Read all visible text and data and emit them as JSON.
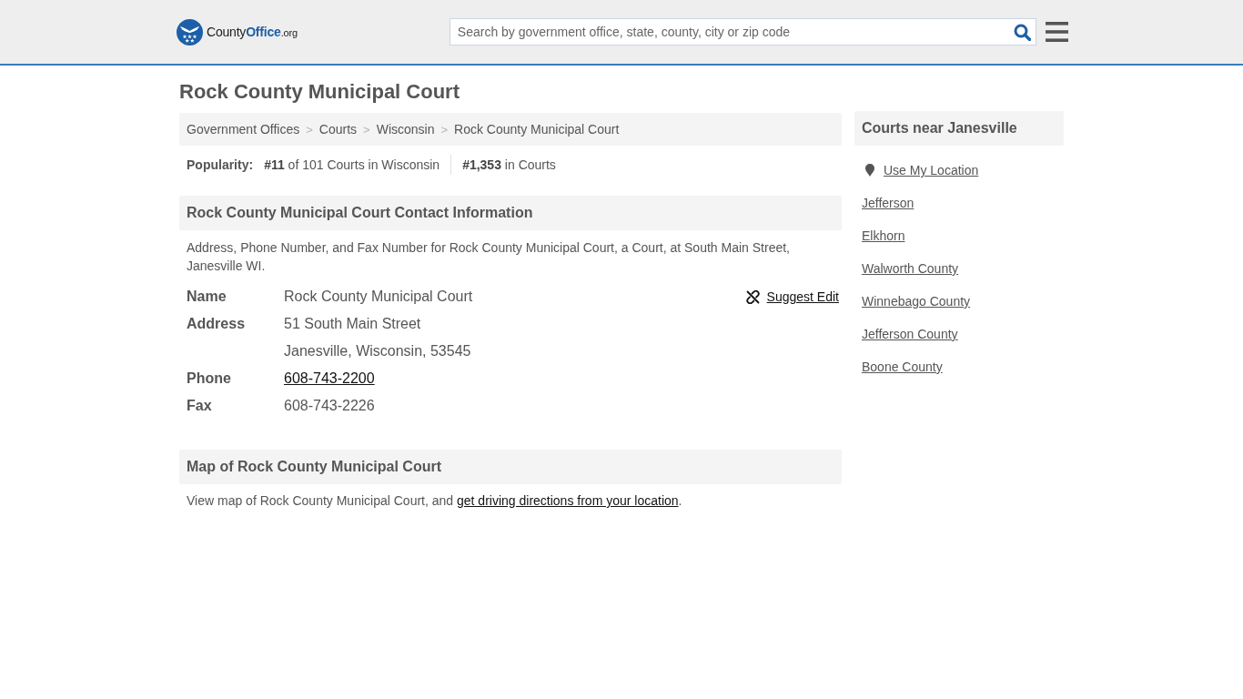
{
  "header": {
    "logo": {
      "parts": [
        {
          "text": "County",
          "kind": "plain"
        },
        {
          "text": "Office",
          "kind": "accent"
        },
        {
          "text": ".org",
          "kind": "suffix"
        }
      ]
    },
    "search": {
      "placeholder": "Search by government office, state, county, city or zip code"
    }
  },
  "page_title": "Rock County Municipal Court",
  "breadcrumbs": [
    {
      "label": "Government Offices"
    },
    {
      "label": "Courts",
      "separator": ">"
    },
    {
      "label": "Wisconsin",
      "separator": ">"
    },
    {
      "label": "Rock County Municipal Court",
      "separator": ">"
    }
  ],
  "popularity": {
    "label": "Popularity:",
    "ranks": [
      "**#11** of 101 Courts in Wisconsin",
      "**#1,353** in Courts"
    ]
  },
  "contact": {
    "title": "Rock County Municipal Court Contact Information",
    "description": "Address, Phone Number, and Fax Number for Rock County Municipal Court, a Court, at South Main Street, Janesville WI.",
    "suggest_edit": "Suggest Edit",
    "fields": [
      {
        "label": "Name",
        "kind": "text",
        "lines": [
          "Rock County Municipal Court"
        ]
      },
      {
        "label": "Address",
        "kind": "text",
        "lines": [
          "51 South Main Street",
          "Janesville, Wisconsin, 53545"
        ]
      },
      {
        "label": "Phone",
        "kind": "link",
        "lines": [
          "608-743-2200"
        ]
      },
      {
        "label": "Fax",
        "kind": "text",
        "lines": [
          "608-743-2226"
        ]
      }
    ]
  },
  "map": {
    "title": "Map of Rock County Municipal Court",
    "text": "View map of Rock County Municipal Court, and ",
    "link": "get driving directions from your location",
    "text_end": "."
  },
  "sidebar": {
    "title": "Courts near Janesville",
    "items": [
      {
        "label": "Use My Location",
        "kind": "location"
      },
      {
        "label": "Jefferson",
        "kind": "link"
      },
      {
        "label": "Elkhorn",
        "kind": "link"
      },
      {
        "label": "Walworth County",
        "kind": "link"
      },
      {
        "label": "Winnebago County",
        "kind": "link"
      },
      {
        "label": "Jefferson County",
        "kind": "link"
      },
      {
        "label": "Boone County",
        "kind": "link"
      }
    ]
  }
}
